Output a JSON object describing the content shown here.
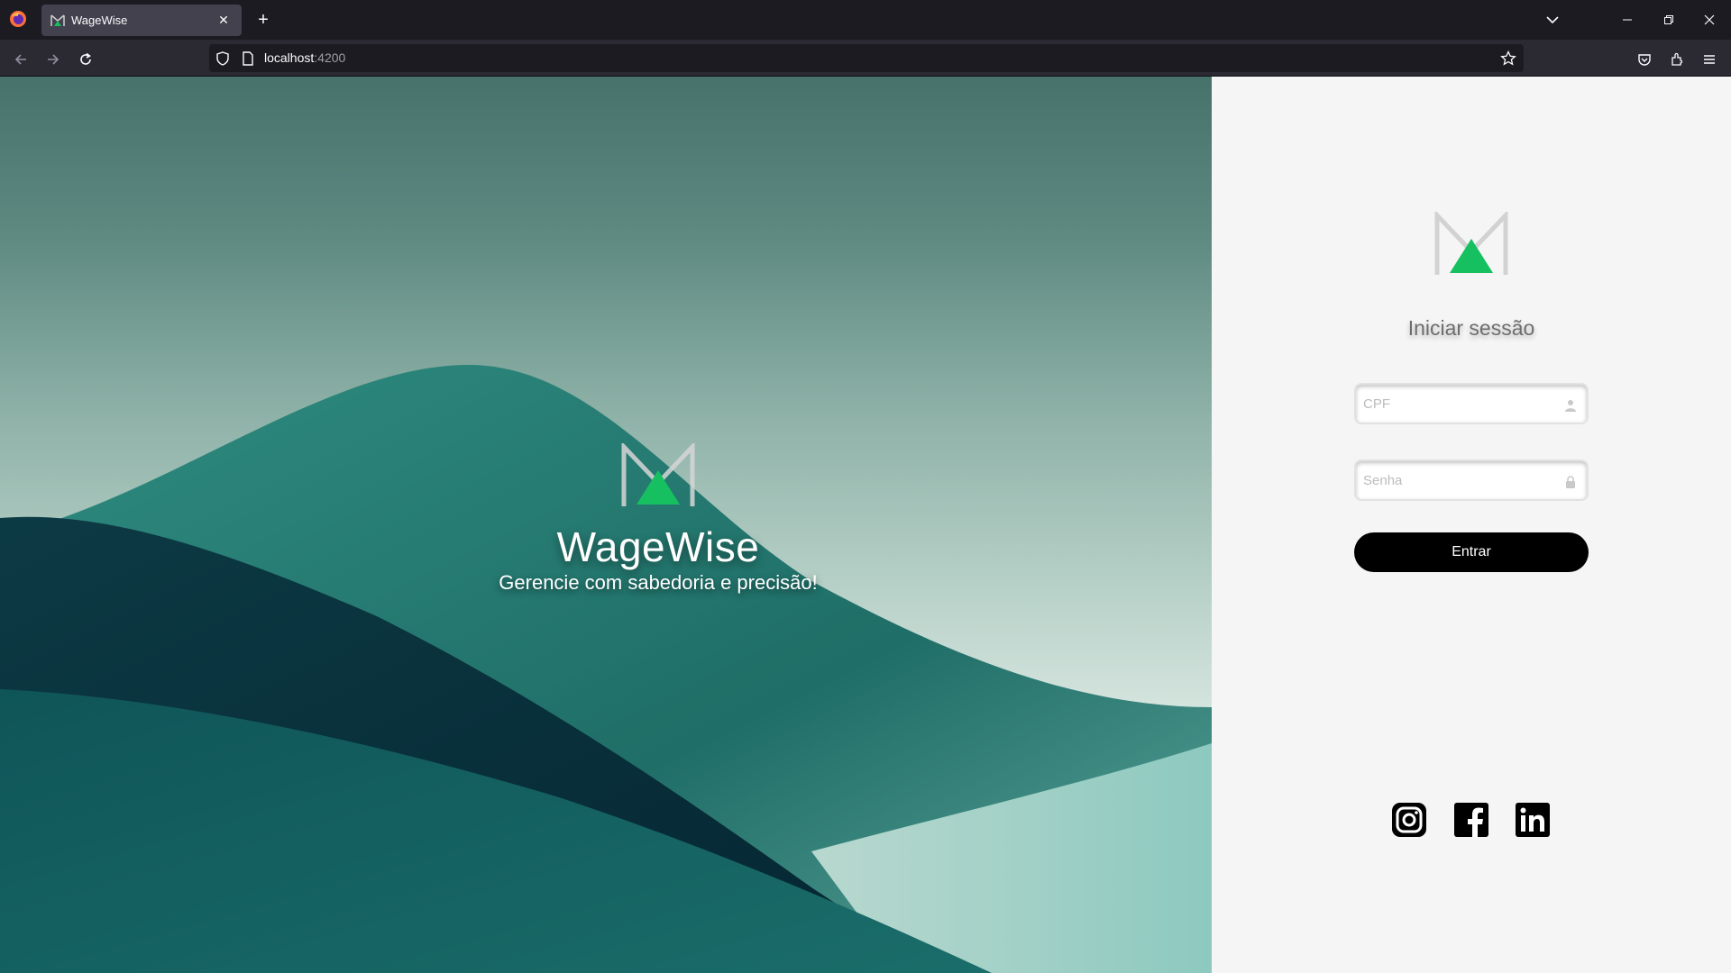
{
  "browser": {
    "tab_title": "WageWise",
    "url_host": "localhost",
    "url_port": ":4200"
  },
  "hero": {
    "title": "WageWise",
    "subtitle": "Gerencie com sabedoria e precisão!"
  },
  "login": {
    "heading": "Iniciar sessão",
    "cpf_placeholder": "CPF",
    "password_placeholder": "Senha",
    "submit_label": "Entrar"
  },
  "colors": {
    "brand_green": "#16c060",
    "logo_gray": "#cfcfcf",
    "button": "#000000"
  },
  "icons": [
    "firefox-icon",
    "close-icon",
    "plus-icon",
    "chevron-down-icon",
    "minimize-icon",
    "restore-icon",
    "back-icon",
    "forward-icon",
    "reload-icon",
    "shield-icon",
    "page-icon",
    "star-icon",
    "pocket-icon",
    "extensions-icon",
    "menu-icon",
    "user-icon",
    "lock-icon",
    "instagram-icon",
    "facebook-icon",
    "linkedin-icon"
  ]
}
